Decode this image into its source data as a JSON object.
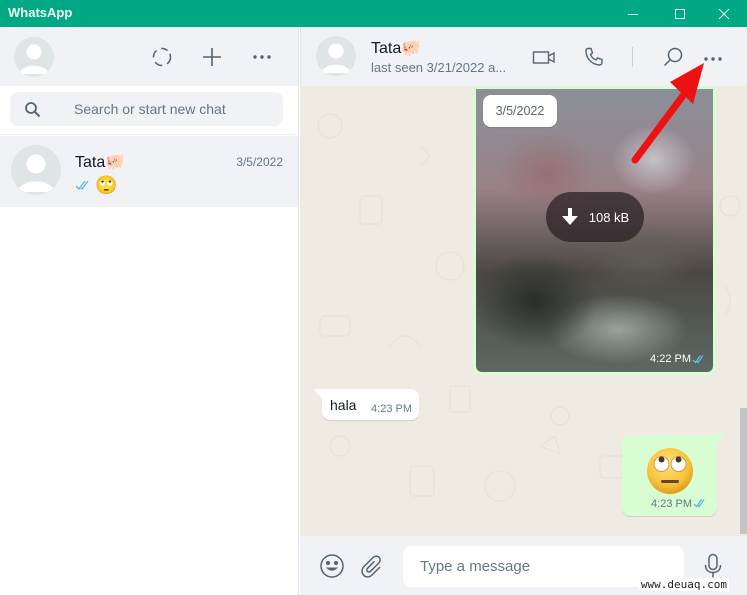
{
  "window": {
    "title": "WhatsApp",
    "controls": [
      "minimize",
      "maximize",
      "close"
    ],
    "accent_color": "#00a884"
  },
  "sidebar": {
    "header_icons": [
      "profile-avatar",
      "status-icon",
      "new-chat-icon",
      "menu-icon"
    ],
    "search": {
      "placeholder": "Search or start new chat",
      "value": ""
    },
    "chats": [
      {
        "name": "Tata🐖",
        "date": "3/5/2022",
        "preview_ticks": "double-check-read",
        "preview_text": "🙄",
        "selected": true
      }
    ]
  },
  "chat": {
    "contact": {
      "name": "Tata🐖",
      "status": "last seen 3/21/2022 a..."
    },
    "header_icons": [
      "video-call-icon",
      "voice-call-icon",
      "search-icon",
      "menu-icon"
    ],
    "messages": [
      {
        "direction": "outgoing",
        "type": "image",
        "date_chip": "3/5/2022",
        "download_size": "108 kB",
        "time": "4:22 PM",
        "ticks": "double-check-read"
      },
      {
        "direction": "incoming",
        "type": "text",
        "text": "hala",
        "time": "4:23 PM"
      },
      {
        "direction": "outgoing",
        "type": "emoji",
        "text": "🙄",
        "time": "4:23 PM",
        "ticks": "double-check-read"
      }
    ],
    "composer": {
      "placeholder": "Type a message",
      "value": "",
      "icons": [
        "emoji-icon",
        "attach-icon",
        "microphone-icon"
      ]
    }
  },
  "annotation": {
    "type": "red-arrow",
    "points_to": "chat-menu-button",
    "color": "#ee1111"
  },
  "watermark": "www.deuaq.com"
}
